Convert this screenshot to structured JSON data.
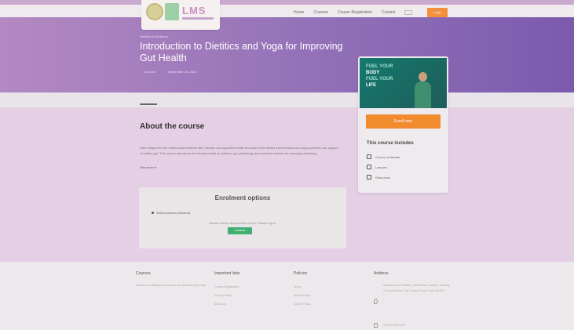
{
  "header": {
    "logo_text": "LMS",
    "nav": [
      "Home",
      "Courses",
      "Course Registration",
      "Contact"
    ],
    "login_label": "Login"
  },
  "hero": {
    "breadcrumb": "Nutrition & Wellness",
    "title": "Introduction to Dietitics and Yoga for Improving Gut Health",
    "meta_category": "Courses",
    "meta_date": "September 26, 2023"
  },
  "tabs": {
    "overview": "Overview"
  },
  "about": {
    "heading": "About the course",
    "description": "Gain insight into the relationship between diet, lifestyle and digestive health and learn how dietary interventions and yoga practices can support a healthy gut. This course introduces the fundamentals of nutrition, gut physiology and practical routines for everyday wellbeing.",
    "see_more": "See more"
  },
  "enrollment": {
    "title": "Enrolment options",
    "option": "Self enrolment (Student)",
    "note": "Guests cannot access this course. Please log in.",
    "button": "Continue"
  },
  "sidebar_card": {
    "thumb_lines": [
      "FUEL YOUR",
      "BODY",
      "FUEL YOUR",
      "LIFE"
    ],
    "enroll_button": "Enroll now",
    "includes_heading": "This course includes",
    "includes": [
      "Course certificate",
      "Lessons",
      "Resources"
    ]
  },
  "footer": {
    "col1": {
      "heading": "Courses",
      "text": "Browse our catalogue of courses and start learning today."
    },
    "col2": {
      "heading": "Important links",
      "links": [
        "Course Registration",
        "Privacy Policy",
        "About Us"
      ]
    },
    "col3": {
      "heading": "Policies",
      "links": [
        "Terms",
        "Refund Policy",
        "Cookie Policy"
      ]
    },
    "col4": {
      "heading": "Address",
      "address": "Department of Nutrition, Main Street Campus, Building 3, Second Floor, City Centre, Postal Code 000000",
      "phone": "+00 000 000 0000"
    }
  }
}
